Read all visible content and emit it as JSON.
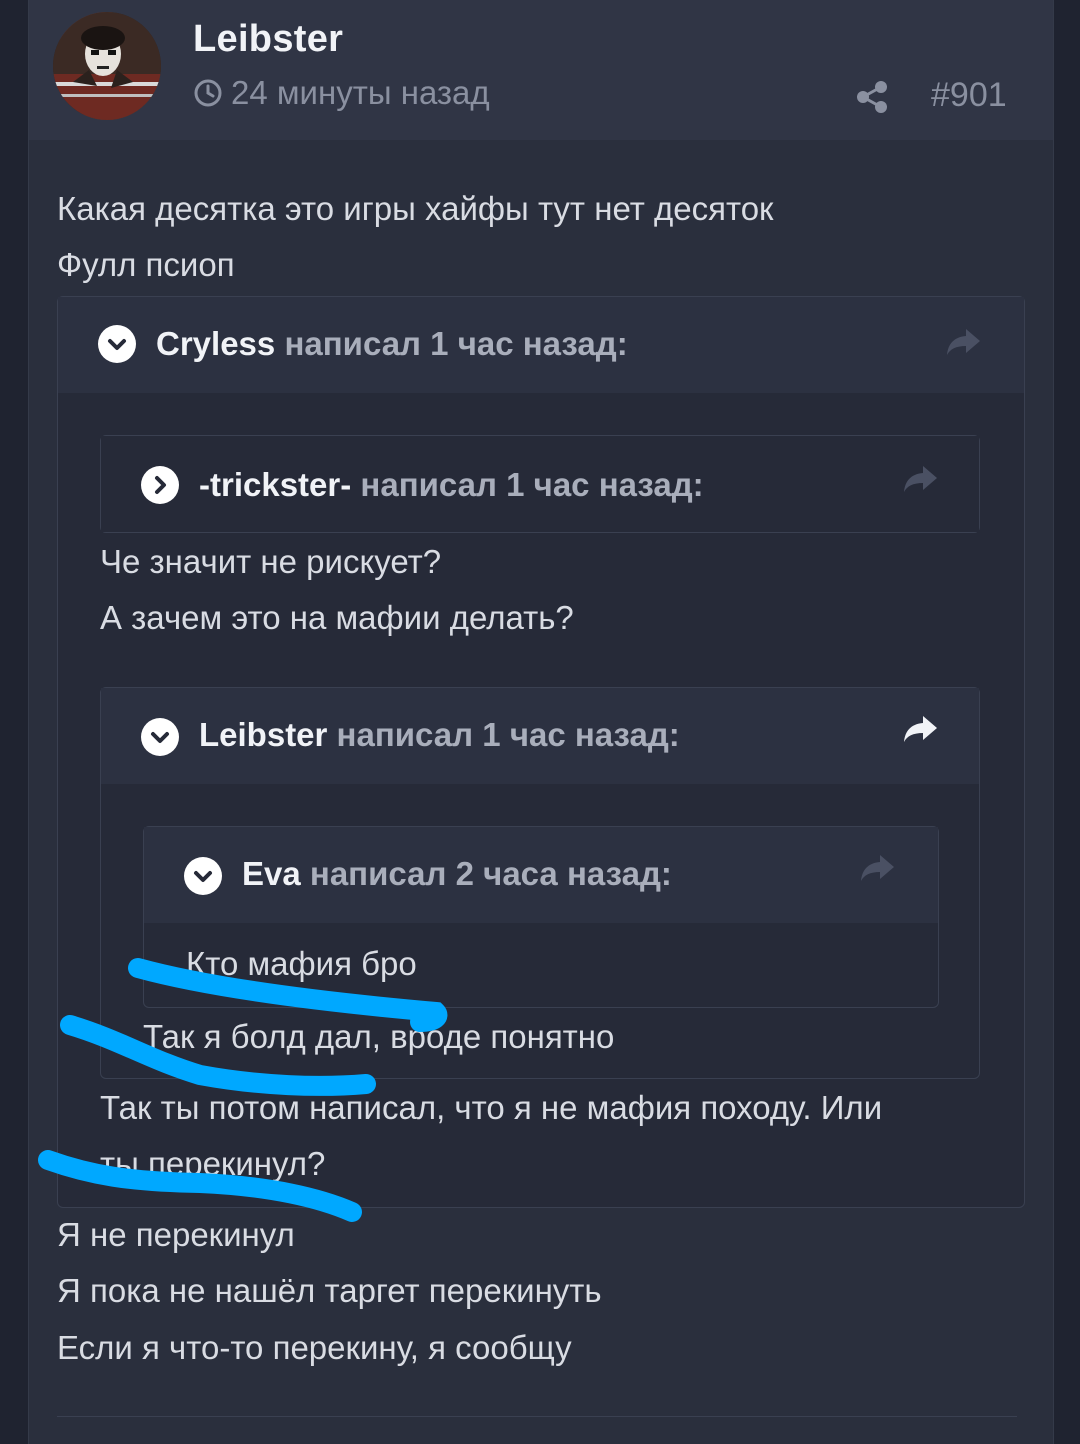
{
  "post": {
    "author": "Leibster",
    "time": "24 минуты назад",
    "number": "#901",
    "intro_lines": [
      "Какая десятка это игры хайфы тут нет десяток",
      "Фулл псиоп"
    ],
    "reply_lines": [
      "Я не перекинул",
      "Я пока не нашёл таргет перекинуть",
      "Если я что-то перекину, я сообщу"
    ]
  },
  "quotes": {
    "cryless": {
      "name": "Cryless",
      "meta": "написал 1 час назад:",
      "after_lines": [
        "Так ты потом написал, что я не мафия походу. Или",
        "ты перекинул?"
      ]
    },
    "trickster": {
      "name": "-trickster-",
      "meta": "написал 1 час назад:",
      "after_lines": [
        "Че значит не рискует?",
        "А зачем это на мафии делать?"
      ]
    },
    "leibster": {
      "name": "Leibster",
      "meta": "написал 1 час назад:",
      "after_lines": [
        "Так я болд дал, вроде понятно"
      ]
    },
    "eva": {
      "name": "Eva",
      "meta": "написал 2 часа назад:",
      "body": "Кто мафия бро"
    }
  },
  "icons": {
    "clock": "clock-icon",
    "share": "share-icon",
    "toggle_expanded": "chevron-down-icon",
    "toggle_collapsed": "chevron-right-icon",
    "reply": "reply-arrow-icon"
  },
  "colors": {
    "background": "#1f2330",
    "panel": "#2a2f3d",
    "quote_bg": "#262a38",
    "highlight": "#00a8ff"
  }
}
